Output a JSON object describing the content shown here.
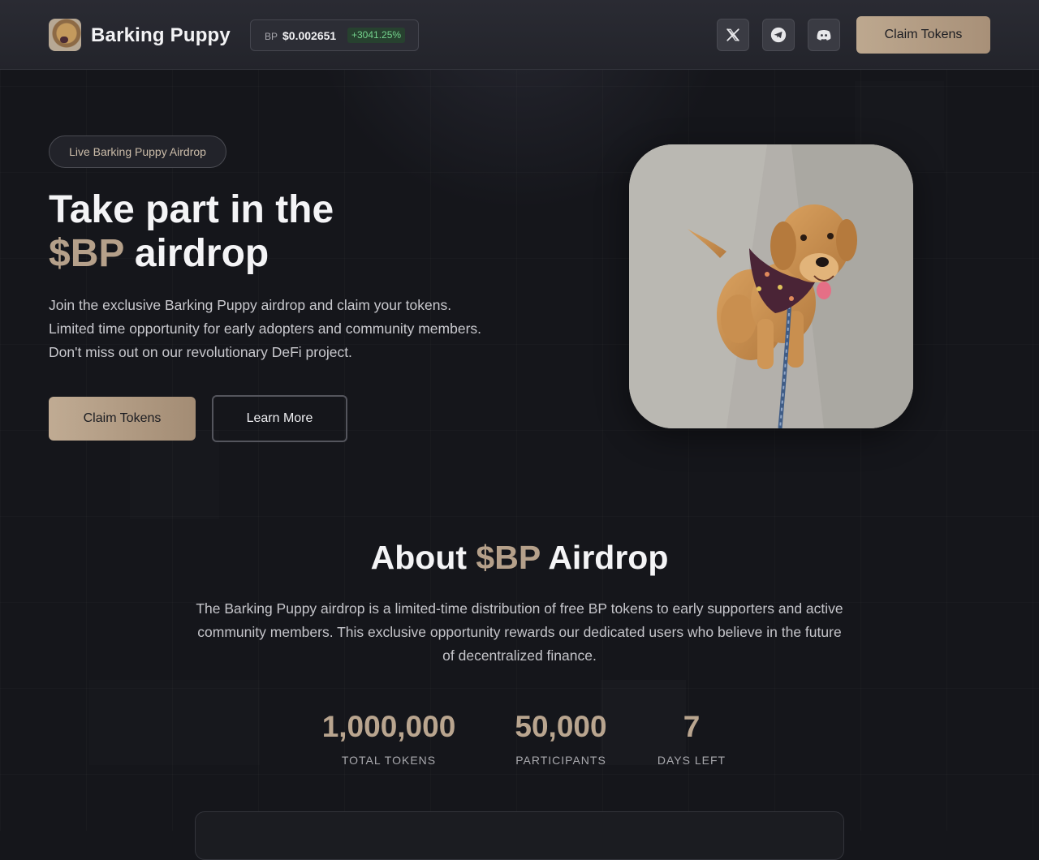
{
  "header": {
    "brand": "Barking Puppy",
    "price": {
      "ticker": "BP",
      "value": "$0.002651",
      "change": "+3041.25%"
    },
    "social": [
      {
        "icon": "x-twitter-icon"
      },
      {
        "icon": "telegram-icon"
      },
      {
        "icon": "discord-icon"
      }
    ],
    "claim_label": "Claim Tokens"
  },
  "hero": {
    "badge": "Live Barking Puppy Airdrop",
    "title_line1": "Take part in the",
    "title_accent": "$BP",
    "title_line2_rest": " airdrop",
    "description": "Join the exclusive Barking Puppy airdrop and claim your tokens. Limited time opportunity for early adopters and community members. Don't miss out on our revolutionary DeFi project.",
    "claim_label": "Claim Tokens",
    "learn_label": "Learn More"
  },
  "about": {
    "title_before": "About ",
    "title_accent": "$BP",
    "title_after": " Airdrop",
    "description": "The Barking Puppy airdrop is a limited-time distribution of free BP tokens to early supporters and active community members. This exclusive opportunity rewards our dedicated users who believe in the future of decentralized finance.",
    "stats": [
      {
        "value": "1,000,000",
        "label": "TOTAL TOKENS"
      },
      {
        "value": "50,000",
        "label": "PARTICIPANTS"
      },
      {
        "value": "7",
        "label": "DAYS LEFT"
      }
    ]
  },
  "colors": {
    "accent": "#b5a08a",
    "background": "#15161b",
    "positive": "#74d38d"
  }
}
